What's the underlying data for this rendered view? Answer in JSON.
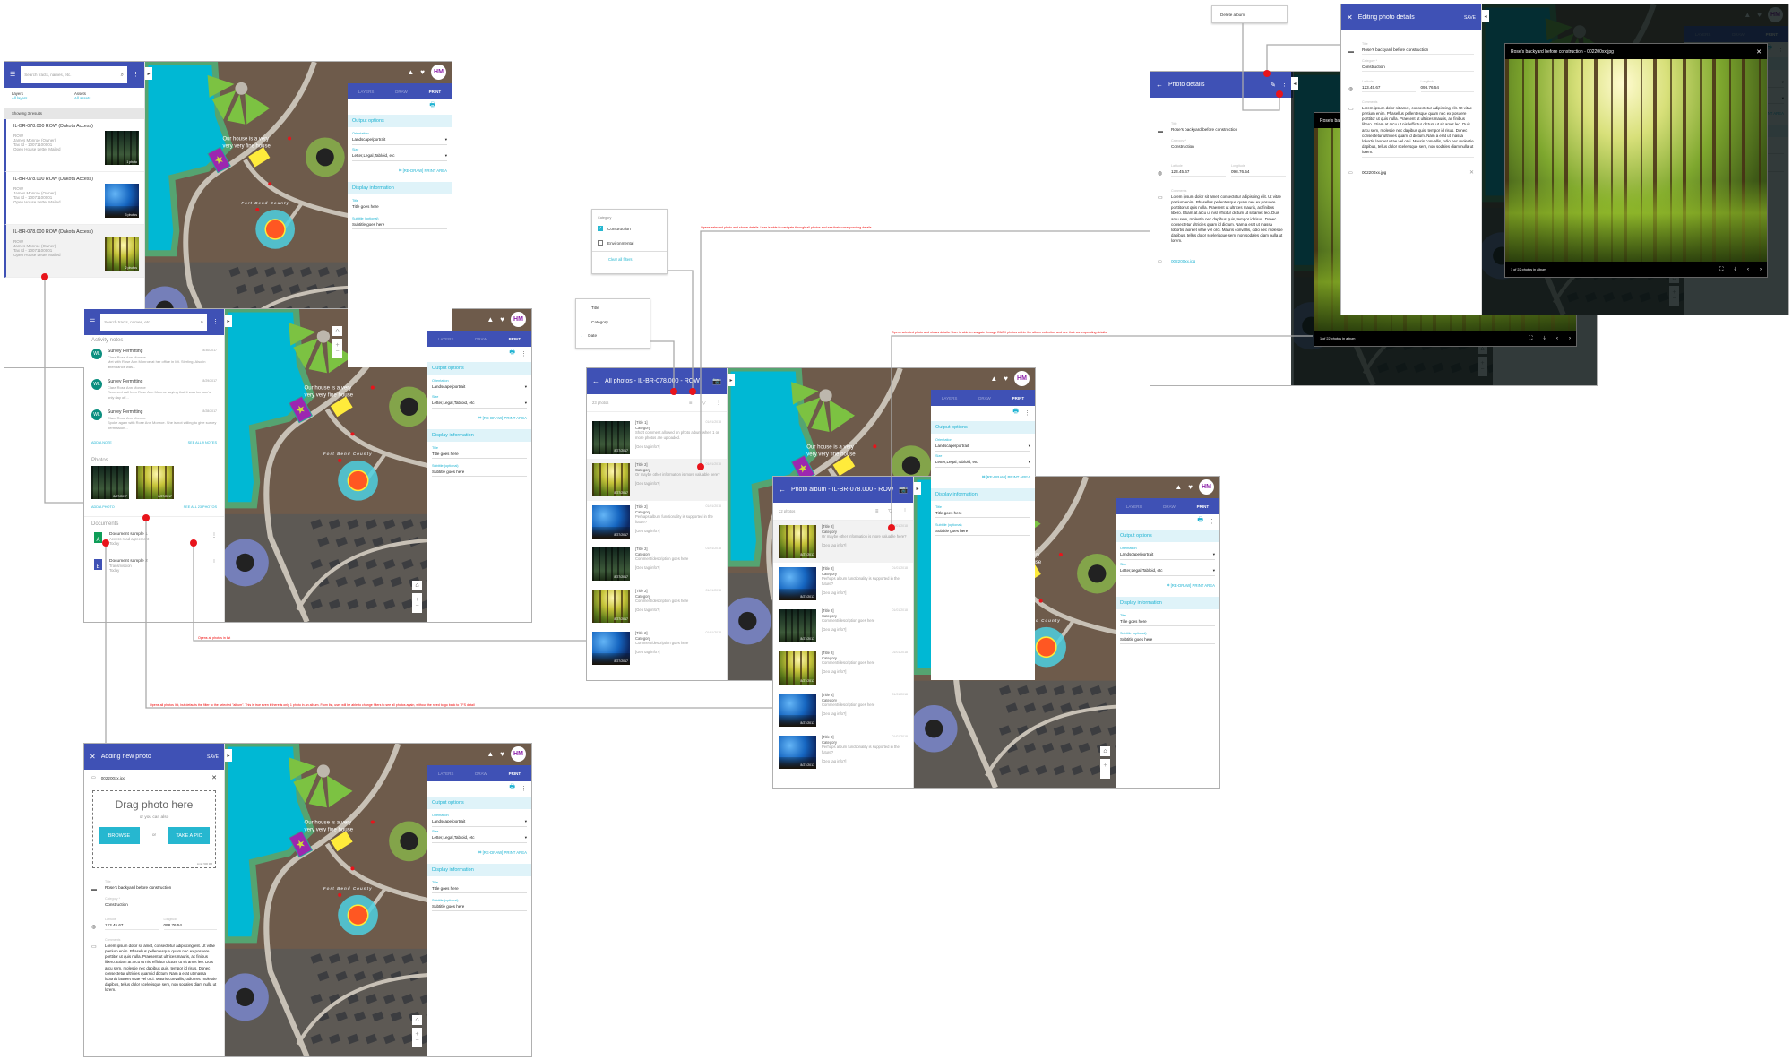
{
  "colors": {
    "primary": "#3f51b5",
    "accent": "#1fb3d2",
    "annotation": "#ff0000",
    "marker": "#e8141b"
  },
  "map": {
    "label_line1": "Our house is a very",
    "label_line2": "very very fine house",
    "county": "Fort Bend County",
    "avatar": "HM",
    "topbar_icons": [
      "terrain-icon",
      "heart-icon"
    ],
    "controls": {
      "home": "⌂",
      "zoom_in": "+",
      "zoom_out": "−"
    }
  },
  "print_panel": {
    "tabs": [
      "LAYERS",
      "DRAW",
      "PRINT"
    ],
    "active_tab": "PRINT",
    "output_options": "Output options",
    "orientation_label": "Orientation",
    "orientation_value": "Landscape/portrait",
    "size_label": "Size",
    "size_value": "Letter,Legal,Tabloid, etc",
    "redraw": "[RE-DRAW] PRINT AREA",
    "display_information": "Display information",
    "title_label": "Title",
    "title_value": "Title goes here",
    "subtitle_label": "Subtitle (optional)",
    "subtitle_value": "Subtitle goes here"
  },
  "search_screen": {
    "search_placeholder": "Search tracts, names, etc.",
    "layers_label": "Layers",
    "layers_value": "All layers",
    "assets_label": "Assets",
    "assets_value": "All assets",
    "results": "Showing 3 results",
    "items": [
      {
        "title": "IL-BR-078.000 ROW (Dakota Access)",
        "type": "ROW",
        "owner": "James Monroe (Owner)",
        "tax": "Tax Id - 10071100001",
        "status": "Open House Letter Mailed",
        "photos": "1 photo",
        "thumb": "dark"
      },
      {
        "title": "IL-BR-078.000 ROW (Dakota Access)",
        "type": "ROW",
        "owner": "James Monroe (Owner)",
        "tax": "Tax Id - 10071100001",
        "status": "Open House Letter Mailed",
        "photos": "3 photos",
        "thumb": "blue"
      },
      {
        "title": "IL-BR-078.000 ROW (Dakota Access)",
        "type": "ROW",
        "owner": "James Monroe (Owner)",
        "tax": "Tax Id - 10071100001",
        "status": "Open House Letter Mailed",
        "photos": "2 photos",
        "thumb": "yellow"
      }
    ]
  },
  "tract_screen": {
    "search_placeholder": "Search tracts, names, etc.",
    "activity_title": "Activity notes",
    "notes": [
      {
        "initials": "WL",
        "title": "Survey Permitting",
        "date": "8/30/2017",
        "author": "Clara Rose Ann Monroe",
        "text": "Met with Rose Ann Monroe at her office in Mt. Sterling. Also in attendance was..."
      },
      {
        "initials": "WL",
        "title": "Survey Permitting",
        "date": "8/29/2017",
        "author": "Clara Rose Ann Monroe",
        "text": "Received call from Rose Ann Monroe saying that it was her son's only day off..."
      },
      {
        "initials": "WL",
        "title": "Survey Permitting",
        "date": "8/28/2017",
        "author": "Clara Rose Ann Monroe",
        "text": "Spoke again with Rose Ann Monroe. She is not willing to give survey permission..."
      }
    ],
    "add_note": "ADD A NOTE",
    "see_notes": "SEE ALL 9 NOTES",
    "photos_title": "Photos",
    "photos": [
      {
        "date": "8/27/2017",
        "thumb": "dark"
      },
      {
        "date": "8/27/2017",
        "thumb": "yellow"
      }
    ],
    "add_photo": "ADD A PHOTO",
    "see_photos": "SEE ALL 23 PHOTOS",
    "documents_title": "Documents",
    "documents": [
      {
        "icon": "A",
        "name": "Document sample 1",
        "desc": "Access road agreement",
        "date": "Today",
        "color": "#0f9d58"
      },
      {
        "icon": "E",
        "name": "Document sample 2",
        "desc": "Transmission",
        "date": "Today",
        "color": "#3f51b5"
      }
    ]
  },
  "all_photos": {
    "title": "All photos - IL-BR-078.000 - ROW",
    "count": "23 photos",
    "items": [
      {
        "title": "[Title 1]",
        "category": "Category",
        "comment": "Short comment allowed on photo album when 1 or more photos are uploaded.",
        "geo": "[Geo tag info?]",
        "date": "01/01/2018",
        "thumb": "dark",
        "thumb_date": "8/27/2017"
      },
      {
        "title": "[Title 2]",
        "category": "Category",
        "comment": "Or maybe other information is more valuable here?",
        "geo": "[Geo tag info?]",
        "date": "01/01/2018",
        "thumb": "yellow",
        "thumb_date": "8/27/2017",
        "selected": true
      },
      {
        "title": "[Title 2]",
        "category": "Category",
        "comment": "Perhaps album functionality is supported in the future?",
        "geo": "[Geo tag info?]",
        "date": "01/01/2018",
        "thumb": "blue",
        "thumb_date": "8/27/2017"
      },
      {
        "title": "[Title 2]",
        "category": "Category",
        "comment": "Comment/description goes here",
        "geo": "[Geo tag info?]",
        "date": "01/01/2018",
        "thumb": "dark",
        "thumb_date": "8/27/2017"
      },
      {
        "title": "[Title 2]",
        "category": "Category",
        "comment": "Comment/description goes here",
        "geo": "[Geo tag info?]",
        "date": "01/01/2018",
        "thumb": "yellow",
        "thumb_date": "8/27/2017"
      },
      {
        "title": "[Title 2]",
        "category": "Category",
        "comment": "Comment/description goes here",
        "geo": "[Geo tag info?]",
        "date": "01/01/2018",
        "thumb": "blue",
        "thumb_date": "8/27/2017"
      }
    ]
  },
  "album": {
    "title": "Photo album - IL-BR-078.000 - ROW",
    "count": "22 photos",
    "items": [
      {
        "title": "[Title 2]",
        "category": "Category",
        "comment": "Or maybe other information is more valuable here?",
        "geo": "[Geo tag info?]",
        "date": "01/01/2018",
        "thumb": "yellow",
        "thumb_date": "8/27/2017",
        "selected": true
      },
      {
        "title": "[Title 2]",
        "category": "Category",
        "comment": "Perhaps album functionality is supported in the future?",
        "geo": "[Geo tag info?]",
        "date": "01/01/2018",
        "thumb": "blue",
        "thumb_date": "8/27/2017"
      },
      {
        "title": "[Title 2]",
        "category": "Category",
        "comment": "Comment/description goes here",
        "geo": "[Geo tag info?]",
        "date": "01/01/2018",
        "thumb": "dark",
        "thumb_date": "8/27/2017"
      },
      {
        "title": "[Title 2]",
        "category": "Category",
        "comment": "Comment/description goes here",
        "geo": "[Geo tag info?]",
        "date": "01/01/2018",
        "thumb": "yellow",
        "thumb_date": "8/27/2017"
      },
      {
        "title": "[Title 2]",
        "category": "Category",
        "comment": "Comment/description goes here",
        "geo": "[Geo tag info?]",
        "date": "01/01/2018",
        "thumb": "blue",
        "thumb_date": "8/27/2017"
      },
      {
        "title": "[Title 2]",
        "category": "Category",
        "comment": "Perhaps album functionality is supported in the future?",
        "geo": "[Geo tag info?]",
        "date": "01/01/2018",
        "thumb": "blue",
        "thumb_date": "8/27/2017"
      }
    ]
  },
  "filter_popup": {
    "heading": "Category",
    "options": [
      {
        "label": "Construction",
        "checked": true
      },
      {
        "label": "Environmental",
        "checked": false
      }
    ],
    "clear": "Clear all filters"
  },
  "sort_popup": {
    "options": [
      "Title",
      "Category",
      "Date"
    ],
    "active": "Date"
  },
  "delete_popup": {
    "label": "Delete album"
  },
  "photo_form": {
    "title_label": "Title",
    "title_value": "Rose's backyard before construction",
    "category_label": "Category *",
    "category_value": "Construction",
    "latitude_label": "Latitude",
    "latitude_value": "123.45.67",
    "longitude_label": "Longitude",
    "longitude_value": "098.76.54",
    "comments_label": "Comments",
    "comments_value": "Lorem ipsum dolor sit amet, consectetur adipiscing elit. Ut vitae pretium enim. Phasellus pellentesque quam nec ex posuere porttitor ut quis nulla. Praesent ut ultrices mauris, ac finibus libero. Etiam at arcu ut nisl efficitur dictum ut sit amet leo. Duis arcu sem, molestie nec dapibus quis, tempor id risus. Donec consectetur ultricies quam id dictum. Nam a erat ut massa lobortis laoreet vitae vel orci. Mauris convallis, odio nec molestie dapibus, tellus dolor scelerisque sem, non sodales diam nulla ut lorem.",
    "file_name": "002200xx.jpg"
  },
  "photo_details": {
    "title": "Photo details"
  },
  "editing": {
    "title": "Editing photo details",
    "save": "SAVE"
  },
  "adding": {
    "title": "Adding new photo",
    "save": "SAVE",
    "drag": "Drag photo here",
    "or_also": "or  you can also",
    "browse": "BROWSE",
    "or": "or",
    "take_pic": "TAKE A PIC",
    "limit": "Limit: 500 MB"
  },
  "lightbox": {
    "caption": "Rose's backyard before construction - 002200xx.jpg",
    "counter": "1 of 22 photos in album"
  },
  "annotations": {
    "all_photos_list": "Opens all photos in list",
    "album_filter": "Opens all photos list, but defaults the filter to the selected \"album\".  This is true even if there is only 1 photo in an album.  From list, user will be able to change filters to see all photos again, without the need to go back to TFS detail",
    "selected_photo_all": "Opens selected photo and shows details. User is able to navigate through all photos and see their corresponding details.",
    "selected_photo_album": "Opens selected photo and shows details. User is able to navigate through EACH photos within the album collection and see their corresponding details."
  }
}
